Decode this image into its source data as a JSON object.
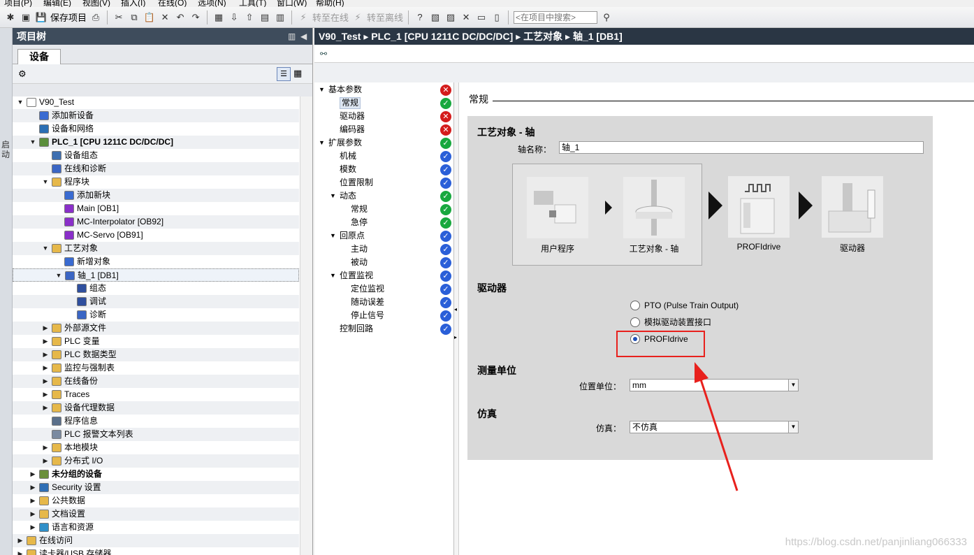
{
  "menu": [
    "项目(P)",
    "编辑(E)",
    "视图(V)",
    "插入(I)",
    "在线(O)",
    "选项(N)",
    "工具(T)",
    "窗口(W)",
    "帮助(H)"
  ],
  "toolbar": {
    "save_label": "保存项目",
    "go_online": "转至在线",
    "go_offline": "转至离线",
    "search_placeholder": "<在项目中搜索>"
  },
  "sidebar_strip": {
    "label": "启动"
  },
  "tree": {
    "title": "项目树",
    "tab": "设备",
    "items": [
      {
        "label": "V90_Test",
        "level": 0,
        "arrow": "open",
        "icon": "project-icon",
        "color": "#ffffff"
      },
      {
        "label": "添加新设备",
        "level": 1,
        "arrow": "",
        "icon": "add-device-icon",
        "color": "#3a6bd1"
      },
      {
        "label": "设备和网络",
        "level": 1,
        "arrow": "",
        "icon": "network-icon",
        "color": "#2b6fb4"
      },
      {
        "label": "PLC_1 [CPU 1211C DC/DC/DC]",
        "level": 1,
        "arrow": "open",
        "icon": "plc-icon",
        "color": "#5b8f3c",
        "bold": true
      },
      {
        "label": "设备组态",
        "level": 2,
        "arrow": "",
        "icon": "device-config-icon",
        "color": "#3e6fb0"
      },
      {
        "label": "在线和诊断",
        "level": 2,
        "arrow": "",
        "icon": "diagnostics-icon",
        "color": "#3b66c4"
      },
      {
        "label": "程序块",
        "level": 2,
        "arrow": "open",
        "icon": "folder-icon",
        "color": "#e6b84a"
      },
      {
        "label": "添加新块",
        "level": 3,
        "arrow": "",
        "icon": "add-block-icon",
        "color": "#3a6bd1"
      },
      {
        "label": "Main [OB1]",
        "level": 3,
        "arrow": "",
        "icon": "ob-block-icon",
        "color": "#8a2fc9"
      },
      {
        "label": "MC-Interpolator [OB92]",
        "level": 3,
        "arrow": "",
        "icon": "ob-block-icon",
        "color": "#8a2fc9"
      },
      {
        "label": "MC-Servo [OB91]",
        "level": 3,
        "arrow": "",
        "icon": "ob-block-icon",
        "color": "#8a2fc9"
      },
      {
        "label": "工艺对象",
        "level": 2,
        "arrow": "open",
        "icon": "folder-icon",
        "color": "#e6b84a"
      },
      {
        "label": "新增对象",
        "level": 3,
        "arrow": "",
        "icon": "add-object-icon",
        "color": "#3a6bd1"
      },
      {
        "label": "轴_1 [DB1]",
        "level": 3,
        "arrow": "open",
        "icon": "axis-icon",
        "color": "#3b66c4",
        "selected": true
      },
      {
        "label": "组态",
        "level": 4,
        "arrow": "",
        "icon": "configuration-icon",
        "color": "#2f4f9e"
      },
      {
        "label": "调试",
        "level": 4,
        "arrow": "",
        "icon": "commissioning-icon",
        "color": "#2f4f9e"
      },
      {
        "label": "诊断",
        "level": 4,
        "arrow": "",
        "icon": "diagnostics-icon",
        "color": "#3b66c4"
      },
      {
        "label": "外部源文件",
        "level": 2,
        "arrow": "closed",
        "icon": "folder-icon",
        "color": "#e6b84a"
      },
      {
        "label": "PLC 变量",
        "level": 2,
        "arrow": "closed",
        "icon": "folder-icon",
        "color": "#e6b84a"
      },
      {
        "label": "PLC 数据类型",
        "level": 2,
        "arrow": "closed",
        "icon": "folder-icon",
        "color": "#e6b84a"
      },
      {
        "label": "监控与强制表",
        "level": 2,
        "arrow": "closed",
        "icon": "folder-icon",
        "color": "#e6b84a"
      },
      {
        "label": "在线备份",
        "level": 2,
        "arrow": "closed",
        "icon": "folder-icon",
        "color": "#e6b84a"
      },
      {
        "label": "Traces",
        "level": 2,
        "arrow": "closed",
        "icon": "folder-icon",
        "color": "#e6b84a"
      },
      {
        "label": "设备代理数据",
        "level": 2,
        "arrow": "closed",
        "icon": "folder-icon",
        "color": "#e6b84a"
      },
      {
        "label": "程序信息",
        "level": 2,
        "arrow": "",
        "icon": "program-info-icon",
        "color": "#5a6f8a"
      },
      {
        "label": "PLC 报警文本列表",
        "level": 2,
        "arrow": "",
        "icon": "alarm-list-icon",
        "color": "#7a8aa0"
      },
      {
        "label": "本地模块",
        "level": 2,
        "arrow": "closed",
        "icon": "folder-icon",
        "color": "#e6b84a"
      },
      {
        "label": "分布式 I/O",
        "level": 2,
        "arrow": "closed",
        "icon": "folder-icon",
        "color": "#e6b84a"
      },
      {
        "label": "未分组的设备",
        "level": 1,
        "arrow": "closed",
        "icon": "ungrouped-devices-icon",
        "color": "#6a8f3a",
        "bold": true
      },
      {
        "label": "Security 设置",
        "level": 1,
        "arrow": "closed",
        "icon": "security-icon",
        "color": "#2f6fb5"
      },
      {
        "label": "公共数据",
        "level": 1,
        "arrow": "closed",
        "icon": "folder-icon",
        "color": "#e6b84a"
      },
      {
        "label": "文档设置",
        "level": 1,
        "arrow": "closed",
        "icon": "folder-icon",
        "color": "#e6b84a"
      },
      {
        "label": "语言和资源",
        "level": 1,
        "arrow": "closed",
        "icon": "language-icon",
        "color": "#2f8fc8"
      },
      {
        "label": "在线访问",
        "level": 0,
        "arrow": "closed",
        "icon": "online-access-icon",
        "color": "#e6b84a"
      },
      {
        "label": "读卡器/USB 存储器",
        "level": 0,
        "arrow": "closed",
        "icon": "card-reader-icon",
        "color": "#e6b84a"
      }
    ]
  },
  "breadcrumb": [
    "V90_Test",
    "PLC_1 [CPU 1211C DC/DC/DC]",
    "工艺对象",
    "轴_1 [DB1]"
  ],
  "nav": {
    "items": [
      {
        "label": "基本参数",
        "level": 0,
        "arrow": "open",
        "status": "err"
      },
      {
        "label": "常规",
        "level": 1,
        "arrow": "",
        "status": "ok",
        "selected": true
      },
      {
        "label": "驱动器",
        "level": 1,
        "arrow": "",
        "status": "err"
      },
      {
        "label": "编码器",
        "level": 1,
        "arrow": "",
        "status": "err"
      },
      {
        "label": "扩展参数",
        "level": 0,
        "arrow": "open",
        "status": "ok"
      },
      {
        "label": "机械",
        "level": 1,
        "arrow": "",
        "status": "info"
      },
      {
        "label": "模数",
        "level": 1,
        "arrow": "",
        "status": "info"
      },
      {
        "label": "位置限制",
        "level": 1,
        "arrow": "",
        "status": "info"
      },
      {
        "label": "动态",
        "level": 1,
        "arrow": "open",
        "status": "ok"
      },
      {
        "label": "常规",
        "level": 2,
        "arrow": "",
        "status": "ok"
      },
      {
        "label": "急停",
        "level": 2,
        "arrow": "",
        "status": "ok"
      },
      {
        "label": "回原点",
        "level": 1,
        "arrow": "open",
        "status": "info"
      },
      {
        "label": "主动",
        "level": 2,
        "arrow": "",
        "status": "info"
      },
      {
        "label": "被动",
        "level": 2,
        "arrow": "",
        "status": "info"
      },
      {
        "label": "位置监视",
        "level": 1,
        "arrow": "open",
        "status": "info"
      },
      {
        "label": "定位监视",
        "level": 2,
        "arrow": "",
        "status": "info"
      },
      {
        "label": "随动误差",
        "level": 2,
        "arrow": "",
        "status": "info"
      },
      {
        "label": "停止信号",
        "level": 2,
        "arrow": "",
        "status": "info"
      },
      {
        "label": "控制回路",
        "level": 1,
        "arrow": "",
        "status": "info"
      }
    ]
  },
  "content": {
    "section_title": "常规",
    "box_heading": "工艺对象 - 轴",
    "axis_name_label": "轴名称：",
    "axis_name_value": "轴_1",
    "diagram": {
      "user_program": "用户程序",
      "tech_object": "工艺对象 - 轴",
      "profidrive": "PROFIdrive",
      "drive": "驱动器"
    },
    "drive_heading": "驱动器",
    "drive_options": [
      {
        "label": "PTO (Pulse Train Output)",
        "checked": false
      },
      {
        "label": "模拟驱动装置接口",
        "checked": false
      },
      {
        "label": "PROFIdrive",
        "checked": true
      }
    ],
    "unit_heading": "测量单位",
    "position_unit_label": "位置单位：",
    "position_unit_value": "mm",
    "sim_heading": "仿真",
    "sim_label": "仿真：",
    "sim_value": "不仿真"
  },
  "watermark": "https://blog.csdn.net/panjinliang066333",
  "colors": {
    "title_bar": "#3e4c5c",
    "breadcrumb_bar": "#2a3644",
    "annotation_red": "#e8211d",
    "status_error": "#d41c1c",
    "status_ok": "#18a83e",
    "status_info": "#2a5fd8"
  }
}
